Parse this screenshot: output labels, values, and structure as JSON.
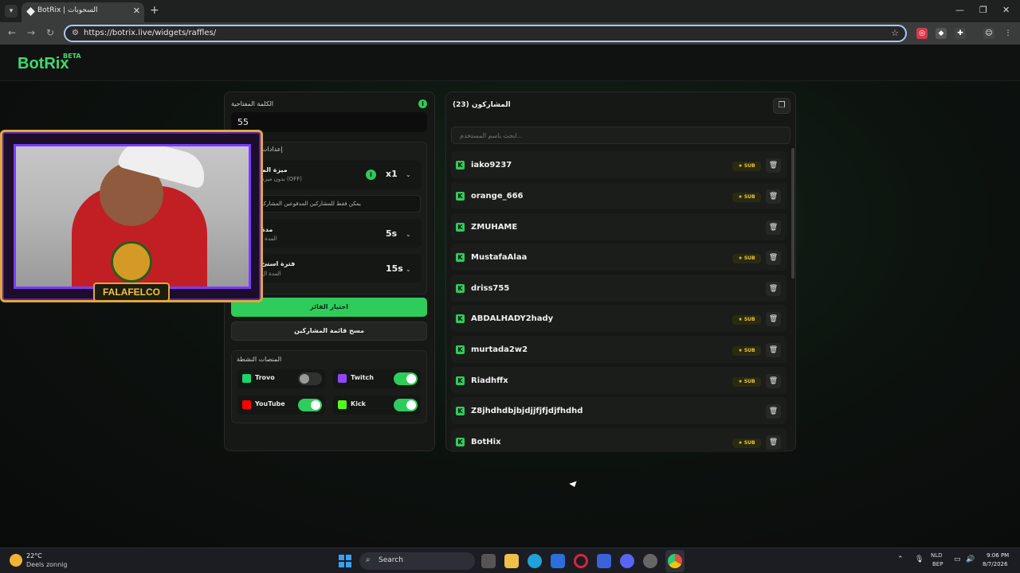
{
  "browser": {
    "tab_title": "BotRix | السحوبات",
    "url": "https://botrix.live/widgets/raffles/"
  },
  "site": {
    "logo": "BotRix",
    "logo_badge": "BETA"
  },
  "raffle_settings": {
    "keyword_label": "الكلمة المفتاحية",
    "keyword_value": "55",
    "settings_label": "إعدادات",
    "luck_title": "ميزة الم",
    "luck_subtitle": "بدون ميزة (OFF)",
    "luck_multiplier": "x1",
    "subscribers_note": "يمكن فقط للمشاركين المدفوعين المشاركة",
    "duration_title": "مدة",
    "duration_subtitle": "المدة ا",
    "duration_value": "5s",
    "interval_title": "فترة استئ",
    "interval_subtitle": "المدة ال",
    "interval_value": "15s",
    "pick_winner_button": "اختيار الفائز",
    "clear_list_button": "مسح قائمة المشاركين",
    "platforms_label": "المنصات النشطة",
    "platforms": [
      {
        "name": "Trovo",
        "enabled": false,
        "color": "#19d66b"
      },
      {
        "name": "Twitch",
        "enabled": true,
        "color": "#9146ff"
      },
      {
        "name": "YouTube",
        "enabled": true,
        "color": "#ff0000"
      },
      {
        "name": "Kick",
        "enabled": true,
        "color": "#53fc18"
      }
    ]
  },
  "participants": {
    "title": "المشاركون (23)",
    "search_placeholder": "ابحث باسم المستخدم...",
    "sub_badge_label": "SUB",
    "list": [
      {
        "username": "iako9237",
        "sub": true
      },
      {
        "username": "orange_666",
        "sub": true
      },
      {
        "username": "ZMUHAME",
        "sub": false
      },
      {
        "username": "MustafaAlaa",
        "sub": true
      },
      {
        "username": "driss755",
        "sub": false
      },
      {
        "username": "ABDALHADY2hady",
        "sub": true
      },
      {
        "username": "murtada2w2",
        "sub": true
      },
      {
        "username": "Riadhffx",
        "sub": true
      },
      {
        "username": "Z8jhdhdbjbjdjjfjfjdjfhdhd",
        "sub": false
      },
      {
        "username": "BotHix",
        "sub": true
      }
    ]
  },
  "overlay": {
    "mascot_text": "FALAFELCO"
  },
  "taskbar": {
    "weather_temp": "22°C",
    "weather_desc": "Deels zonnig",
    "search_label": "Search",
    "lang_top": "NLD",
    "lang_bottom": "BEP",
    "time": "9:06 PM",
    "date": "8/7/2026"
  },
  "colors": {
    "accent": "#2ecc5a",
    "sub_badge": "#e8c93c"
  }
}
